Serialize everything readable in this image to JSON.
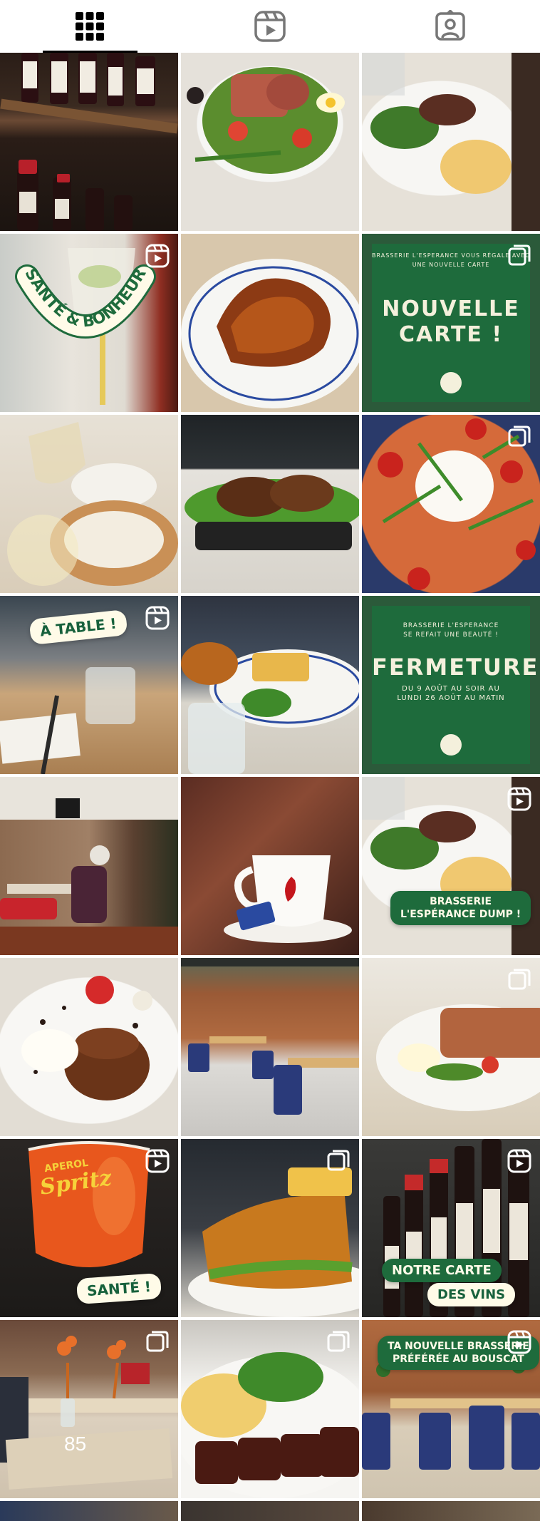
{
  "tabs": [
    {
      "name": "grid",
      "icon": "grid-icon",
      "active": true
    },
    {
      "name": "reels",
      "icon": "reels-icon",
      "active": false
    },
    {
      "name": "tagged",
      "icon": "tagged-icon",
      "active": false
    }
  ],
  "posts": {
    "sante_bonheur": "SANTÉ & BONHEUR",
    "nouvelle_carte": {
      "small": "BRASSERIE L'ESPERANCE VOUS RÉGALE AVEC UNE NOUVELLE CARTE",
      "big_1": "NOUVELLE",
      "big_2": "CARTE !"
    },
    "a_table": "À TABLE !",
    "fermeture": {
      "small_1": "BRASSERIE L'ESPERANCE",
      "small_2": "SE REFAIT UNE BEAUTÉ !",
      "big": "FERMETURE",
      "dates_1": "DU 9 AOÛT AU SOIR AU",
      "dates_2": "LUNDI 26 AOÛT AU MATIN"
    },
    "dump_1": "BRASSERIE",
    "dump_2": "L'ESPÉRANCE DUMP !",
    "spritz_brand": "APEROL",
    "spritz": "Spritz",
    "sante": "SANTÉ !",
    "carte_vins_1": "NOTRE CARTE",
    "carte_vins_2": "DES VINS",
    "bouscat_1": "TA NOUVELLE BRASSERIE",
    "bouscat_2": "PRÉFÉRÉE AU BOUSCAT",
    "table_number": "85"
  }
}
